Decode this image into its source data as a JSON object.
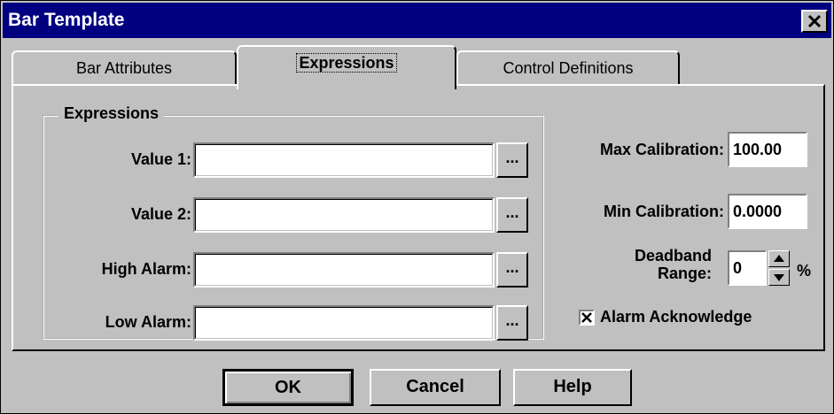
{
  "window": {
    "title": "Bar Template"
  },
  "tabs": [
    {
      "label": "Bar Attributes",
      "active": false
    },
    {
      "label": "Expressions",
      "active": true
    },
    {
      "label": "Control Definitions",
      "active": false
    }
  ],
  "expressions_group": {
    "title": "Expressions",
    "rows": [
      {
        "label": "Value 1:",
        "value": "",
        "browse_label": "..."
      },
      {
        "label": "Value 2:",
        "value": "",
        "browse_label": "..."
      },
      {
        "label": "High Alarm:",
        "value": "",
        "browse_label": "..."
      },
      {
        "label": "Low Alarm:",
        "value": "",
        "browse_label": "..."
      }
    ]
  },
  "calibration": {
    "max_label": "Max Calibration:",
    "max_value": "100.00",
    "min_label": "Min Calibration:",
    "min_value": "0.0000",
    "deadband_label_line1": "Deadband",
    "deadband_label_line2": "Range:",
    "deadband_value": "0",
    "deadband_unit": "%"
  },
  "alarm_ack": {
    "label": "Alarm Acknowledge",
    "checked": true
  },
  "buttons": {
    "ok": "OK",
    "cancel": "Cancel",
    "help": "Help"
  }
}
